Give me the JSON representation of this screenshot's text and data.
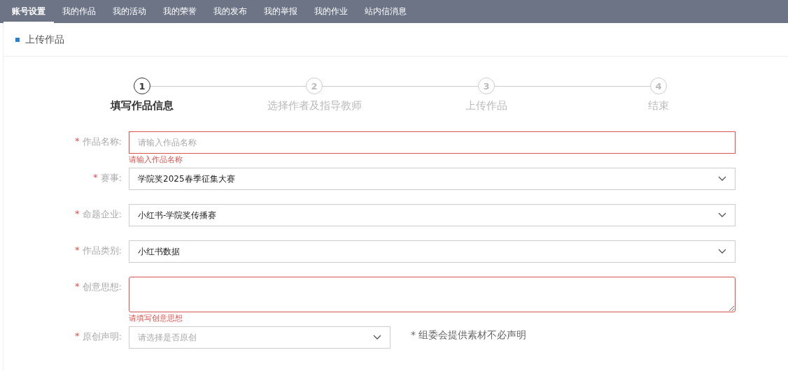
{
  "nav": [
    {
      "label": "账号设置",
      "selected": true
    },
    {
      "label": "我的作品",
      "selected": false
    },
    {
      "label": "我的活动",
      "selected": false
    },
    {
      "label": "我的荣誉",
      "selected": false
    },
    {
      "label": "我的发布",
      "selected": false
    },
    {
      "label": "我的举报",
      "selected": false
    },
    {
      "label": "我的作业",
      "selected": false
    },
    {
      "label": "站内信消息",
      "selected": false
    }
  ],
  "page_title": "上传作品",
  "steps": [
    {
      "number": "1",
      "label": "填写作品信息",
      "selected": true
    },
    {
      "number": "2",
      "label": "选择作者及指导教师",
      "selected": false
    },
    {
      "number": "3",
      "label": "上传作品",
      "selected": false
    },
    {
      "number": "4",
      "label": "结束",
      "selected": false
    }
  ],
  "fields": [
    {
      "kind": "text",
      "required_mark": "*",
      "label": "作品名称:",
      "placeholder": "请输入作品名称",
      "error": "请输入作品名称"
    },
    {
      "kind": "select",
      "required_mark": "*",
      "label": "赛事:",
      "value": "学院奖2025春季征集大赛"
    },
    {
      "kind": "select",
      "required_mark": "*",
      "label": "命题企业:",
      "value": "小红书-学院奖传播赛"
    },
    {
      "kind": "select",
      "required_mark": "*",
      "label": "作品类别:",
      "value": "小红书数据"
    },
    {
      "kind": "textarea",
      "required_mark": "*",
      "label": "创意思想:",
      "error": "请填写创意思想"
    },
    {
      "kind": "select-short",
      "required_mark": "*",
      "label": "原创声明:",
      "placeholder": "请选择是否原创",
      "note": "* 组委会提供素材不必声明"
    }
  ]
}
